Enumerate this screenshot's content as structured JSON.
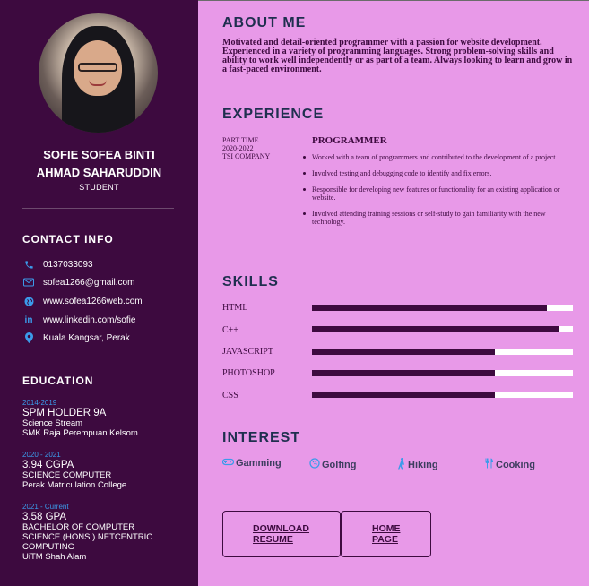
{
  "profile": {
    "name_line1": "SOFIE SOFEA BINTI",
    "name_line2": "AHMAD SAHARUDDIN",
    "role": "STUDENT"
  },
  "contact": {
    "heading": "CONTACT INFO",
    "items": [
      {
        "icon": "phone-icon",
        "text": "0137033093"
      },
      {
        "icon": "mail-icon",
        "text": "sofea1266@gmail.com"
      },
      {
        "icon": "globe-icon",
        "text": "www.sofea1266web.com"
      },
      {
        "icon": "linkedin-icon",
        "text": "www.linkedin.com/sofie"
      },
      {
        "icon": "location-pin-icon",
        "text": "Kuala Kangsar, Perak"
      }
    ]
  },
  "education": {
    "heading": "EDUCATION",
    "items": [
      {
        "years": "2014-2019",
        "degree": "SPM HOLDER 9A",
        "line1": "Science Stream",
        "line2": "SMK Raja Perempuan Kelsom"
      },
      {
        "years": "2020 - 2021",
        "degree": "3.94 CGPA",
        "line1": "SCIENCE COMPUTER",
        "line2": "Perak Matriculation College"
      },
      {
        "years": "2021 - Current",
        "degree": "3.58 GPA",
        "line1": "BACHELOR OF COMPUTER",
        "line2": "SCIENCE (HONS.) NETCENTRIC",
        "line3": "COMPUTING",
        "line4": "UiTM Shah Alam"
      }
    ]
  },
  "about": {
    "heading": "ABOUT ME",
    "text": "Motivated and detail-oriented programmer with a passion for website development. Experienced in a variety of programming languages. Strong problem-solving skills and ability to work well independently or as part of a team. Always looking to learn and grow in a fast-paced environment."
  },
  "experience": {
    "heading": "EXPERIENCE",
    "type": "PART TIME",
    "period": "2020-2022",
    "company": "TSI COMPANY",
    "title": "PROGRAMMER",
    "duties": [
      "Worked with a team of programmers and contributed to the development of a project.",
      "Involved testing and debugging code to identify and fix errors.",
      "Responsible for developing new features or functionality for an existing application or website.",
      "Involved attending training sessions or self-study to gain familiarity with the new technology."
    ]
  },
  "skills": {
    "heading": "SKILLS",
    "items": [
      {
        "name": "HTML",
        "level": 0.9
      },
      {
        "name": "C++",
        "level": 0.95
      },
      {
        "name": "JAVASCRIPT",
        "level": 0.7
      },
      {
        "name": "PHOTOSHOP",
        "level": 0.7
      },
      {
        "name": "CSS",
        "level": 0.7
      }
    ]
  },
  "interest": {
    "heading": "INTEREST",
    "items": [
      {
        "icon": "gamepad-icon",
        "label": "Gamming"
      },
      {
        "icon": "golf-ball-icon",
        "label": "Golfing"
      },
      {
        "icon": "hiking-icon",
        "label": "Hiking"
      },
      {
        "icon": "utensils-icon",
        "label": "Cooking"
      }
    ]
  },
  "buttons": {
    "download_line1": "DOWNLOAD",
    "download_line2": "RESUME",
    "home_line1": "HOME",
    "home_line2": "PAGE"
  },
  "colors": {
    "sidebar": "#3d0a3f",
    "main": "#e899e8",
    "accent": "#3b9bea",
    "heading": "#1f2f4f"
  }
}
